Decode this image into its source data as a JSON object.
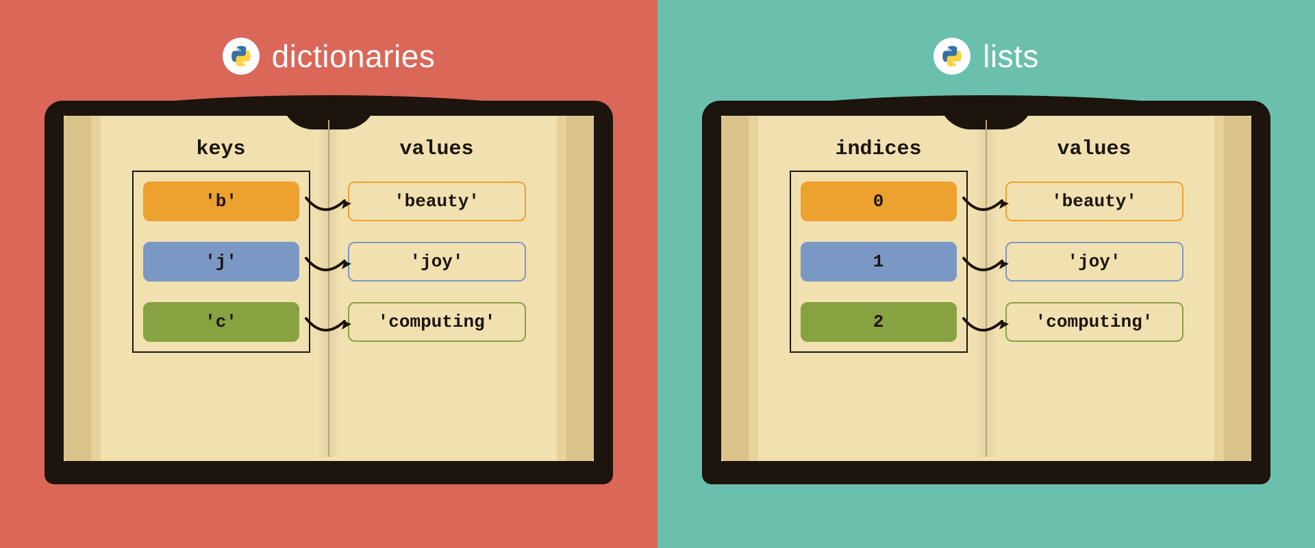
{
  "left": {
    "title": "dictionaries",
    "left_header": "keys",
    "right_header": "values",
    "rows": [
      {
        "key": "'b'",
        "value": "'beauty'",
        "color": "orange"
      },
      {
        "key": "'j'",
        "value": "'joy'",
        "color": "blue"
      },
      {
        "key": "'c'",
        "value": "'computing'",
        "color": "green"
      }
    ]
  },
  "right": {
    "title": "lists",
    "left_header": "indices",
    "right_header": "values",
    "rows": [
      {
        "key": "0",
        "value": "'beauty'",
        "color": "orange"
      },
      {
        "key": "1",
        "value": "'joy'",
        "color": "blue"
      },
      {
        "key": "2",
        "value": "'computing'",
        "color": "green"
      }
    ]
  },
  "colors": {
    "bg_left": "#da6758",
    "bg_right": "#6ac0ac",
    "orange": "#eda12f",
    "blue": "#7b98c5",
    "green": "#87a341",
    "book": "#1c140d",
    "page": "#f1e0b0"
  }
}
